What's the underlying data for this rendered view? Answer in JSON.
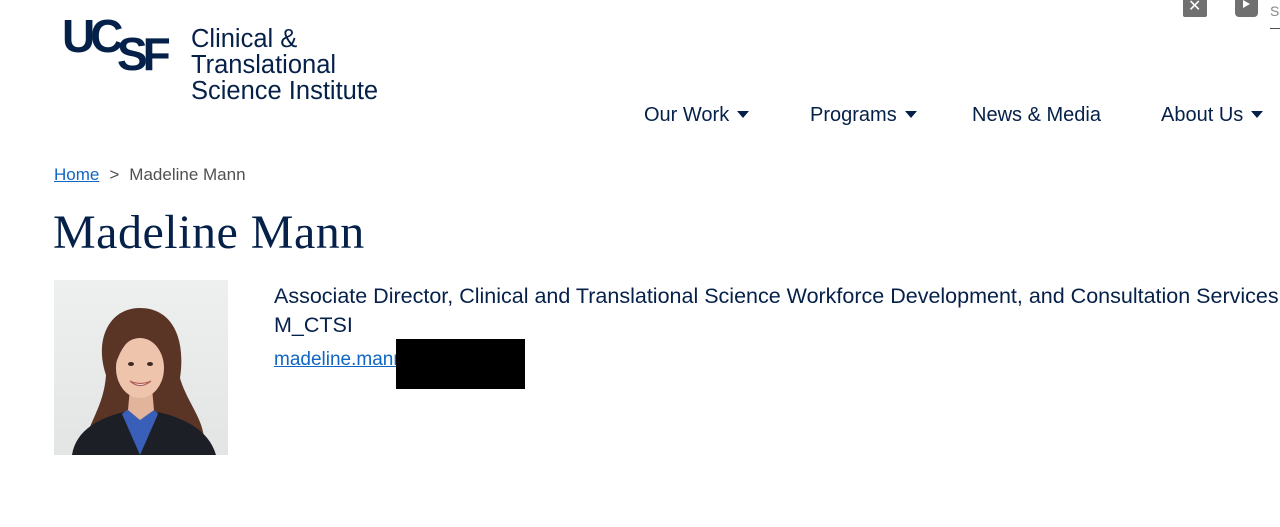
{
  "header": {
    "logo_mark": "UCSF",
    "logo_line1": "Clinical & Translational",
    "logo_line2": "Science Institute",
    "social": [
      "x-icon",
      "youtube-icon"
    ],
    "search_stub": "S"
  },
  "nav": {
    "items": [
      {
        "label": "Our Work",
        "has_dropdown": true
      },
      {
        "label": "Programs",
        "has_dropdown": true
      },
      {
        "label": "News & Media",
        "has_dropdown": false
      },
      {
        "label": "About Us",
        "has_dropdown": true
      }
    ]
  },
  "breadcrumb": {
    "home": "Home",
    "separator": ">",
    "current": "Madeline Mann"
  },
  "profile": {
    "name": "Madeline Mann",
    "job_title": "Associate Director, Clinical and Translational Science Workforce Development, and Consultation Services",
    "department": "M_CTSI",
    "email_visible": "madeline.mann"
  },
  "colors": {
    "brand_navy": "#052049",
    "link_blue": "#0f66c4",
    "text_gray": "#505050"
  }
}
